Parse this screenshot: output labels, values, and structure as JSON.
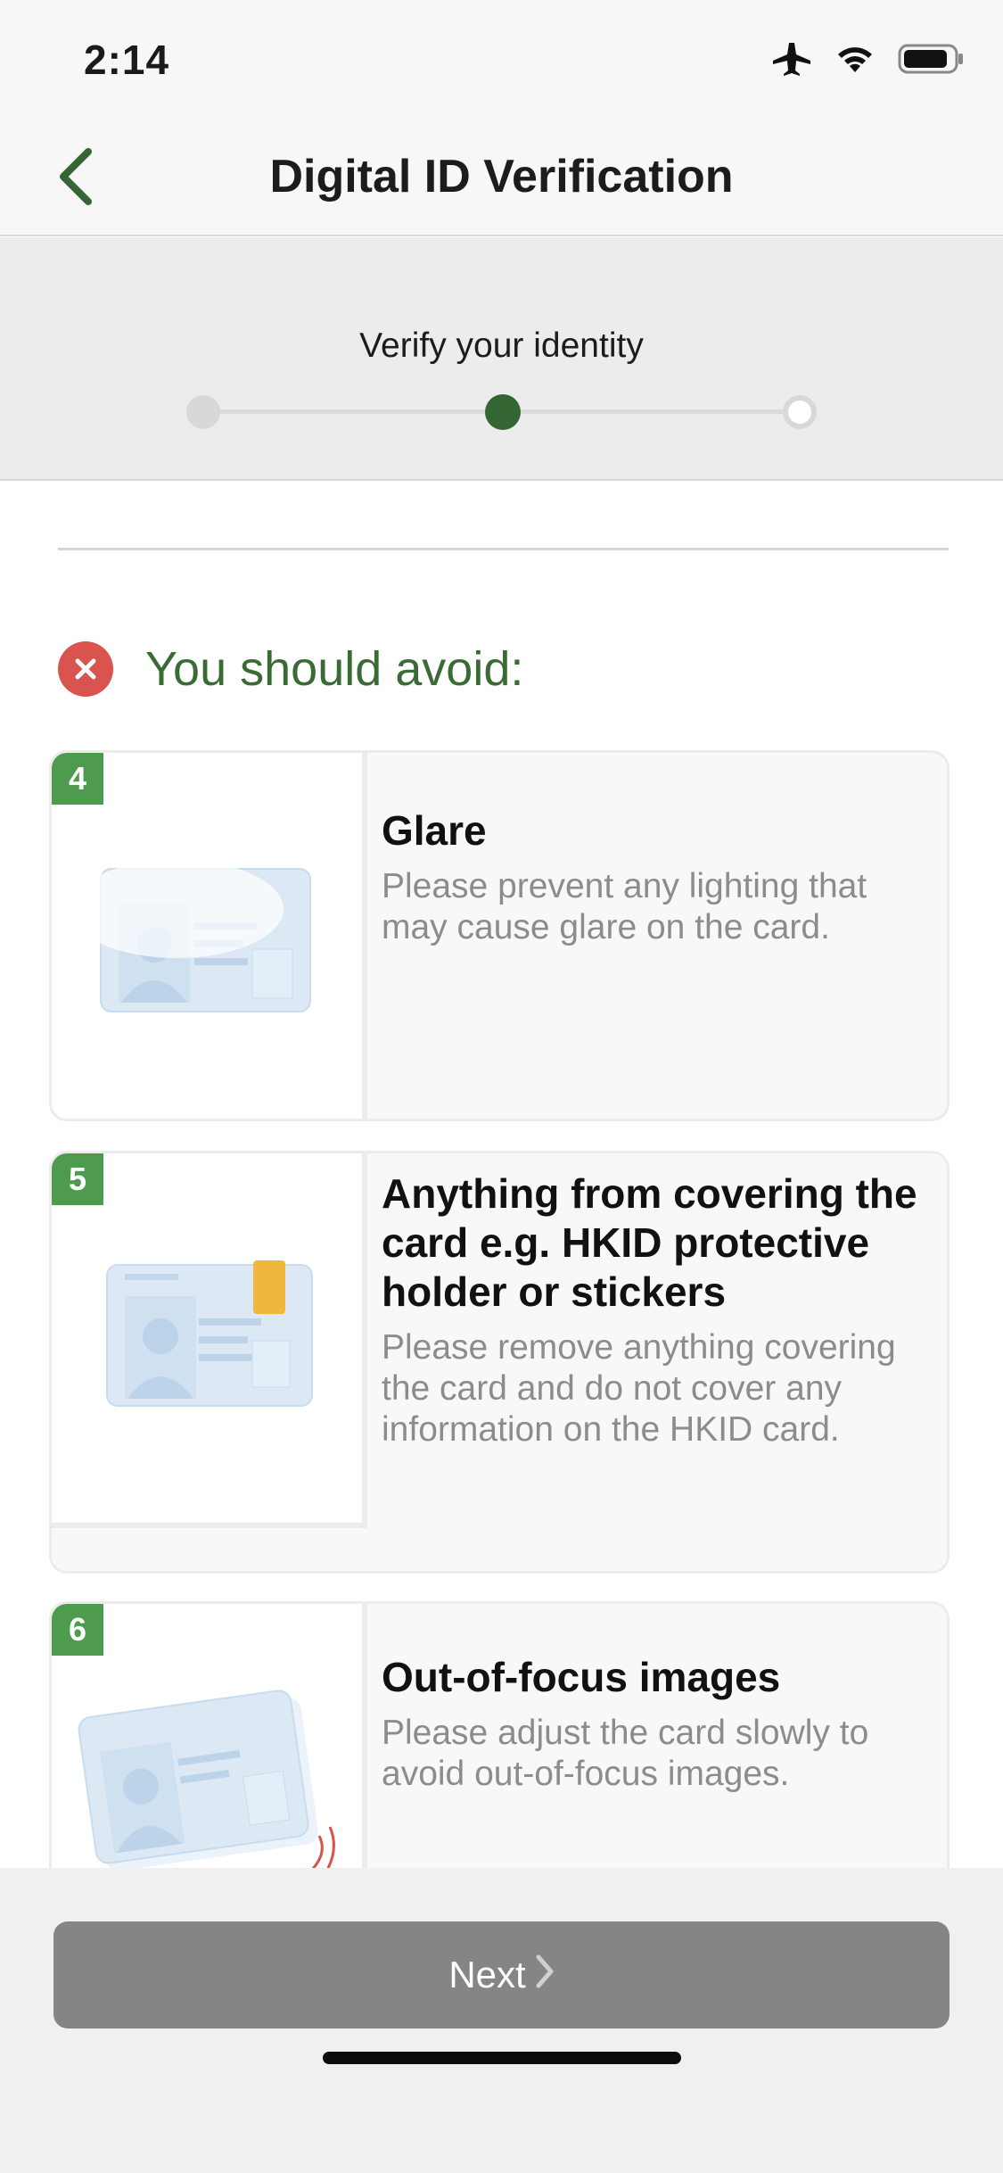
{
  "status_bar": {
    "time": "2:14",
    "icons": [
      "airplane-icon",
      "wifi-icon",
      "battery-icon"
    ]
  },
  "nav": {
    "back_icon": "chevron-left-icon",
    "title": "Digital ID Verification"
  },
  "progress": {
    "label": "Verify your identity",
    "steps": [
      "done",
      "active",
      "todo"
    ]
  },
  "avoid": {
    "icon": "x-circle-icon",
    "title": "You should avoid:"
  },
  "tips": [
    {
      "number": "4",
      "title": "Glare",
      "description": "Please prevent any lighting that may cause glare on the card.",
      "illustration": "id-card-glare-illustration"
    },
    {
      "number": "5",
      "title": "Anything from covering the card e.g. HKID protective holder or stickers",
      "description": "Please remove anything covering the card and do not cover any information on the HKID card.",
      "illustration": "id-card-covered-illustration"
    },
    {
      "number": "6",
      "title": "Out-of-focus images",
      "description": "Please adjust the card slowly to avoid out-of-focus images.",
      "illustration": "id-card-blur-illustration"
    }
  ],
  "footer": {
    "next_label": "Next",
    "next_icon": "chevron-right-icon"
  },
  "colors": {
    "brand_green": "#336633",
    "badge_green": "#4e9a4e",
    "avoid_red": "#d9534f",
    "button_disabled": "#858585"
  }
}
